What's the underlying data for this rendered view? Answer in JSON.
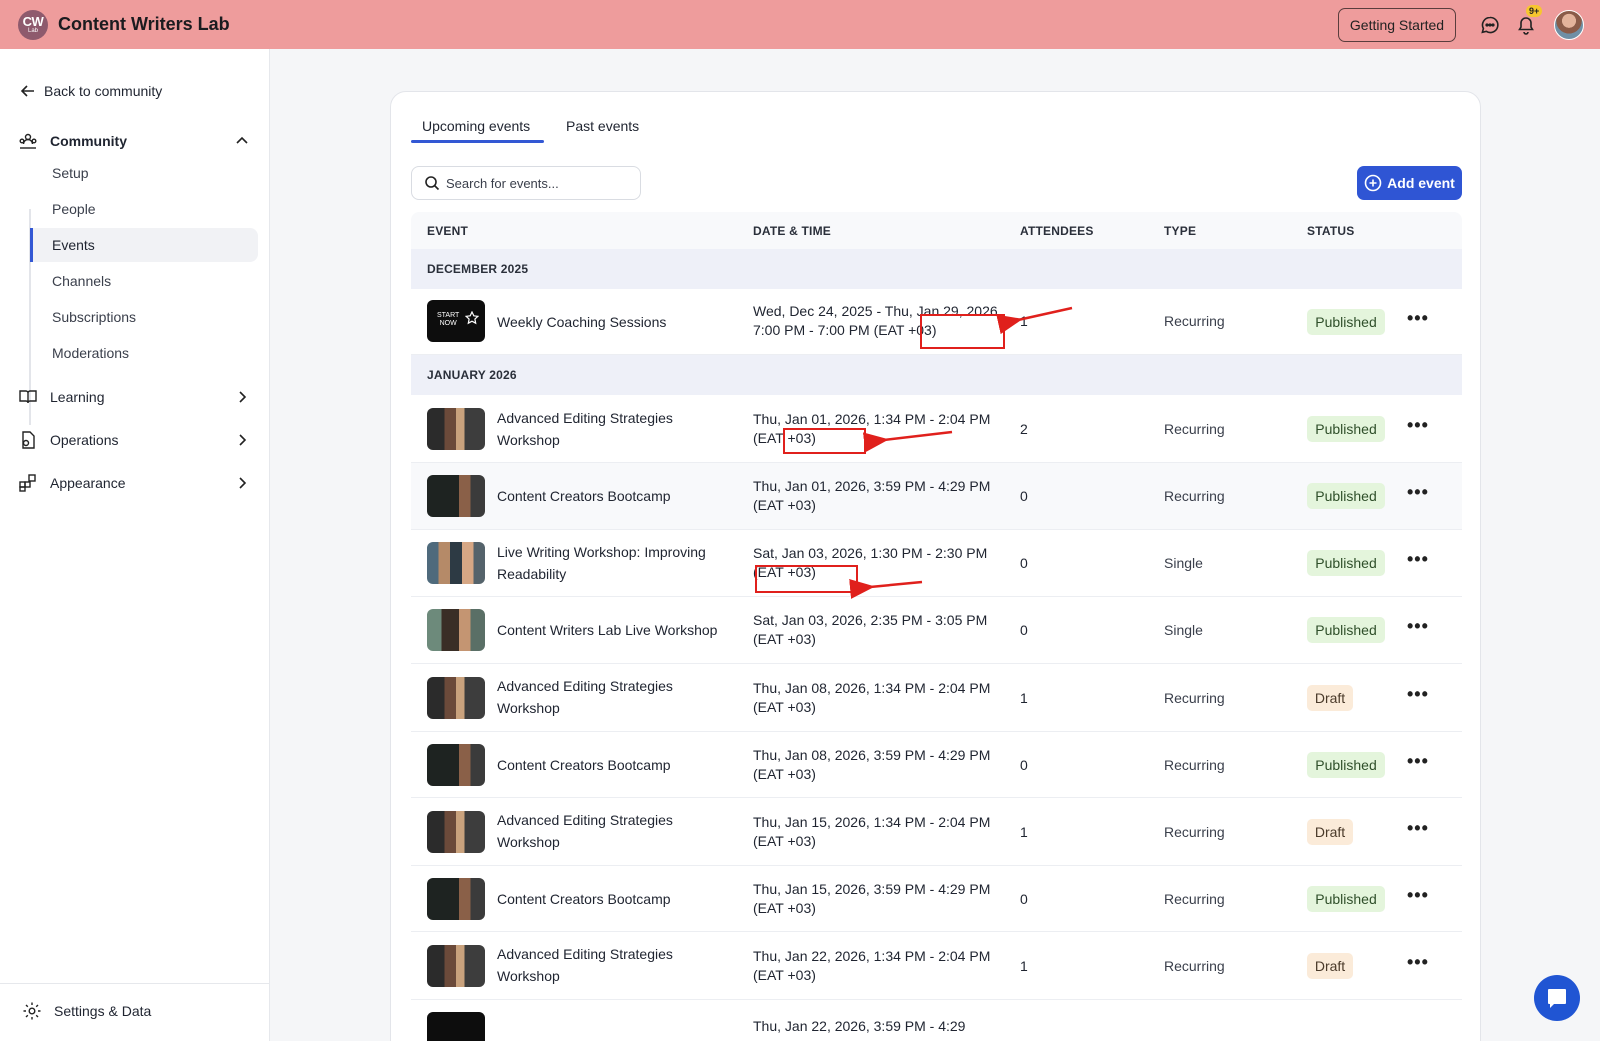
{
  "app": {
    "logo_line1": "CW",
    "logo_line2": "Lab",
    "title": "Content Writers Lab"
  },
  "topbar": {
    "getting_started": "Getting Started",
    "notif_badge": "9+"
  },
  "sidebar": {
    "back": "Back to community",
    "community": "Community",
    "community_items": [
      "Setup",
      "People",
      "Events",
      "Channels",
      "Subscriptions",
      "Moderations"
    ],
    "learning": "Learning",
    "operations": "Operations",
    "appearance": "Appearance",
    "settings": "Settings & Data"
  },
  "tabs": {
    "upcoming": "Upcoming events",
    "past": "Past events"
  },
  "search": {
    "placeholder": "Search for events..."
  },
  "add_event": "Add event",
  "columns": {
    "event": "EVENT",
    "date": "DATE & TIME",
    "attendees": "ATTENDEES",
    "type": "TYPE",
    "status": "STATUS"
  },
  "months": {
    "dec": "DECEMBER 2025",
    "jan": "JANUARY 2026"
  },
  "thumb_text": {
    "start": "START",
    "now": "NOW"
  },
  "events": [
    {
      "name": "Weekly Coaching Sessions",
      "date": "Wed, Dec 24, 2025 - Thu, Jan 29, 2026, 7:00 PM - 7:00 PM (EAT +03)",
      "attendees": "1",
      "type": "Recurring",
      "status": "Published"
    },
    {
      "name": "Advanced Editing Strategies Workshop",
      "date": "Thu, Jan 01, 2026, 1:34 PM - 2:04 PM (EAT +03)",
      "attendees": "2",
      "type": "Recurring",
      "status": "Published"
    },
    {
      "name": "Content Creators Bootcamp",
      "date": "Thu, Jan 01, 2026, 3:59 PM - 4:29 PM (EAT +03)",
      "attendees": "0",
      "type": "Recurring",
      "status": "Published"
    },
    {
      "name": "Live Writing Workshop: Improving Readability",
      "date": "Sat, Jan 03, 2026, 1:30 PM - 2:30 PM (EAT +03)",
      "attendees": "0",
      "type": "Single",
      "status": "Published"
    },
    {
      "name": "Content Writers Lab Live Workshop",
      "date": "Sat, Jan 03, 2026, 2:35 PM - 3:05 PM (EAT +03)",
      "attendees": "0",
      "type": "Single",
      "status": "Published"
    },
    {
      "name": "Advanced Editing Strategies Workshop",
      "date": "Thu, Jan 08, 2026, 1:34 PM - 2:04 PM (EAT +03)",
      "attendees": "1",
      "type": "Recurring",
      "status": "Draft"
    },
    {
      "name": "Content Creators Bootcamp",
      "date": "Thu, Jan 08, 2026, 3:59 PM - 4:29 PM (EAT +03)",
      "attendees": "0",
      "type": "Recurring",
      "status": "Published"
    },
    {
      "name": "Advanced Editing Strategies Workshop",
      "date": "Thu, Jan 15, 2026, 1:34 PM - 2:04 PM (EAT +03)",
      "attendees": "1",
      "type": "Recurring",
      "status": "Draft"
    },
    {
      "name": "Content Creators Bootcamp",
      "date": "Thu, Jan 15, 2026, 3:59 PM - 4:29 PM (EAT +03)",
      "attendees": "0",
      "type": "Recurring",
      "status": "Published"
    },
    {
      "name": "Advanced Editing Strategies Workshop",
      "date": "Thu, Jan 22, 2026, 1:34 PM - 2:04 PM (EAT +03)",
      "attendees": "1",
      "type": "Recurring",
      "status": "Draft"
    },
    {
      "name": "",
      "date": "Thu, Jan 22, 2026, 3:59 PM - 4:29",
      "attendees": "",
      "type": "",
      "status": ""
    }
  ],
  "more_label": "•••",
  "colors": {
    "topbar": "#ee9c9c",
    "accent": "#2f55d4",
    "published_bg": "#e4f5dc",
    "draft_bg": "#fbebd9",
    "annotation": "#e0201c"
  }
}
